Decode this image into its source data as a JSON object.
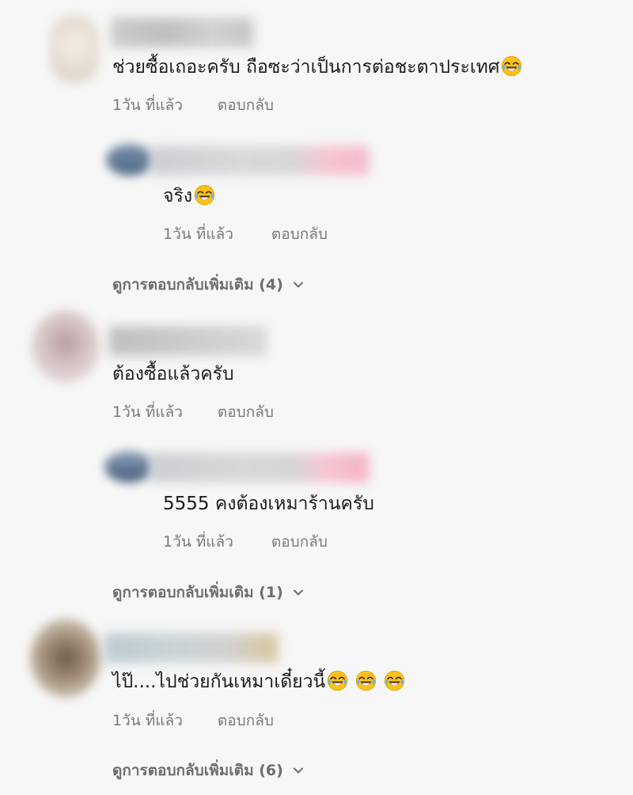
{
  "comments": [
    {
      "text": "ช่วยซื้อเถอะครับ ถือซะว่าเป็นการต่อชะตาประเทศ",
      "emoji_icons": [
        "laughing-tears-emoji"
      ],
      "time": "1วัน ที่แล้ว",
      "reply_label": "ตอบกลับ",
      "reply": {
        "text": "จริง",
        "emoji_icons": [
          "laughing-tears-emoji"
        ],
        "time": "1วัน ที่แล้ว",
        "reply_label": "ตอบกลับ"
      },
      "more_replies": "ดูการตอบกลับเพิ่มเติม (4)"
    },
    {
      "text": "ต้องซื้อแล้วครับ",
      "emoji_icons": [],
      "time": "1วัน ที่แล้ว",
      "reply_label": "ตอบกลับ",
      "reply": {
        "text": "5555 คงต้องเหมาร้านครับ",
        "emoji_icons": [],
        "time": "1วัน ที่แล้ว",
        "reply_label": "ตอบกลับ"
      },
      "more_replies": "ดูการตอบกลับเพิ่มเติม (1)"
    },
    {
      "text": "ไป๊....ไปช่วยกันเหมาเดี๋ยวนี้",
      "emoji_icons": [
        "laughing-tears-emoji",
        "laughing-tears-emoji",
        "laughing-tears-emoji"
      ],
      "time": "1วัน ที่แล้ว",
      "reply_label": "ตอบกลับ",
      "more_replies": "ดูการตอบกลับเพิ่มเติม (6)"
    }
  ],
  "colors": {
    "background": "#f7f7f7",
    "text": "#1c1c1c",
    "meta": "#7a7a7a",
    "more": "#6e6e6e"
  }
}
